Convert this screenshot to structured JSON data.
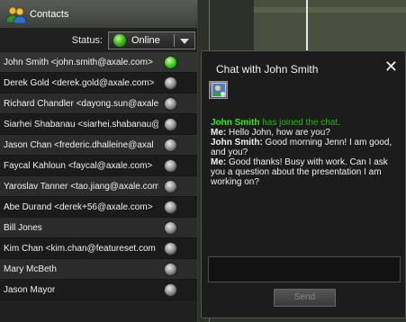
{
  "contacts_panel": {
    "title": "Contacts",
    "status_label": "Status:",
    "status_value": "Online",
    "contacts": [
      {
        "label": "John Smith <john.smith@axale.com>",
        "status": "online"
      },
      {
        "label": "Derek Gold <derek.gold@axale.com>",
        "status": "offline"
      },
      {
        "label": "Richard Chandler <dayong.sun@axale",
        "status": "offline"
      },
      {
        "label": "Siarhei Shabanau <siarhei.shabanau@",
        "status": "offline"
      },
      {
        "label": "Jason Chan <frederic.dhalleine@axal",
        "status": "offline"
      },
      {
        "label": "Faycal Kahloun <faycal@axale.com>",
        "status": "offline"
      },
      {
        "label": "Yaroslav Tanner <tao.jiang@axale.com",
        "status": "offline"
      },
      {
        "label": "Abe Durand <derek+56@axale.com>",
        "status": "offline"
      },
      {
        "label": "Bill Jones",
        "status": "offline"
      },
      {
        "label": "Kim Chan <kim.chan@featureset.com",
        "status": "offline"
      },
      {
        "label": "Mary McBeth",
        "status": "offline"
      },
      {
        "label": "Jason Mayor",
        "status": "offline"
      }
    ]
  },
  "chat": {
    "title": "Chat with John Smith",
    "close_glyph": "✕",
    "join_name": "John Smith",
    "join_text": " has joined the chat.",
    "messages": [
      {
        "speaker": "Me:",
        "text": " Hello John, how are you?"
      },
      {
        "speaker": "John Smith:",
        "text": " Good morning Jenn! I am good, and you?"
      },
      {
        "speaker": "Me:",
        "text": " Good thanks! Busy with work. Can I ask you a question about the presentation I am working on?"
      }
    ],
    "input_value": "",
    "send_label": "Send"
  },
  "colors": {
    "online": "#36c21a",
    "system_message": "#21b80c"
  }
}
